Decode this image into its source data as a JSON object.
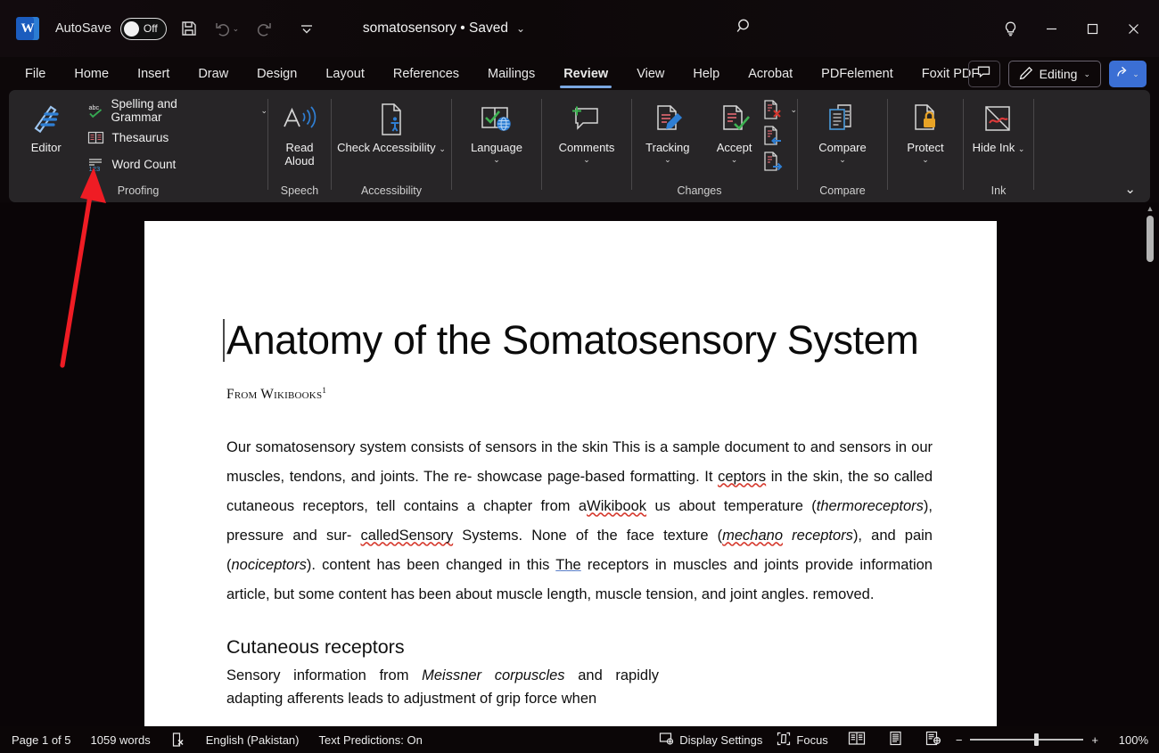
{
  "titlebar": {
    "app_icon": "word-logo",
    "autosave_label": "AutoSave",
    "autosave_state": "Off",
    "save_icon": "save-icon",
    "undo_icon": "undo-icon",
    "redo_icon": "redo-icon",
    "qat_more_icon": "quick-access-more-icon",
    "document_title": "somatosensory • Saved",
    "title_caret": "⌄",
    "search_icon": "search-icon",
    "tips_icon": "lightbulb-icon",
    "minimize": "–",
    "maximize": "▢",
    "close": "✕"
  },
  "tabs": {
    "items": [
      {
        "label": "File",
        "active": false
      },
      {
        "label": "Home",
        "active": false
      },
      {
        "label": "Insert",
        "active": false
      },
      {
        "label": "Draw",
        "active": false
      },
      {
        "label": "Design",
        "active": false
      },
      {
        "label": "Layout",
        "active": false
      },
      {
        "label": "References",
        "active": false
      },
      {
        "label": "Mailings",
        "active": false
      },
      {
        "label": "Review",
        "active": true
      },
      {
        "label": "View",
        "active": false
      },
      {
        "label": "Help",
        "active": false
      },
      {
        "label": "Acrobat",
        "active": false
      },
      {
        "label": "PDFelement",
        "active": false
      },
      {
        "label": "Foxit PDF",
        "active": false
      }
    ],
    "comments_icon": "comment-icon",
    "editing_label": "Editing",
    "editing_icon": "pen-icon",
    "editing_caret": "⌄",
    "share_icon": "share-icon",
    "share_caret": "⌄"
  },
  "ribbon": {
    "collapse_caret": "⌄",
    "groups": [
      {
        "name": "Proofing",
        "label": "Proofing",
        "big": {
          "label": "Editor",
          "icon": "editor-pen-icon"
        },
        "small": [
          {
            "label": "Spelling and Grammar",
            "icon": "spelling-abc-check-icon",
            "caret": "⌄"
          },
          {
            "label": "Thesaurus",
            "icon": "thesaurus-book-icon",
            "caret": ""
          },
          {
            "label": "Word Count",
            "icon": "word-count-icon",
            "caret": ""
          }
        ]
      },
      {
        "name": "Speech",
        "label": "Speech",
        "big": {
          "label": "Read Aloud",
          "icon": "read-aloud-icon"
        }
      },
      {
        "name": "Accessibility",
        "label": "Accessibility",
        "big": {
          "label": "Check Accessibility",
          "icon": "check-accessibility-icon",
          "caret": "⌄"
        }
      },
      {
        "name": "Language",
        "label": "",
        "big": {
          "label": "Language",
          "icon": "language-icon",
          "caret": "⌄"
        }
      },
      {
        "name": "Comments",
        "label": "",
        "big": {
          "label": "Comments",
          "icon": "new-comment-icon",
          "caret": "⌄"
        }
      },
      {
        "name": "Changes",
        "label": "Changes",
        "tracking": {
          "label": "Tracking",
          "icon": "track-changes-icon",
          "caret": "⌄"
        },
        "accept": {
          "label": "Accept",
          "icon": "accept-change-icon",
          "caret": "⌄"
        },
        "stack": [
          {
            "icon": "reject-change-icon",
            "caret": "⌄"
          },
          {
            "icon": "previous-change-icon",
            "caret": ""
          },
          {
            "icon": "next-change-icon",
            "caret": ""
          }
        ]
      },
      {
        "name": "Compare",
        "label": "Compare",
        "big": {
          "label": "Compare",
          "icon": "compare-docs-icon",
          "caret": "⌄"
        }
      },
      {
        "name": "Protect",
        "label": "",
        "big": {
          "label": "Protect",
          "icon": "protect-lock-icon",
          "caret": "⌄"
        }
      },
      {
        "name": "Ink",
        "label": "Ink",
        "big": {
          "label": "Hide Ink",
          "icon": "hide-ink-icon",
          "caret": "⌄"
        }
      }
    ]
  },
  "document": {
    "title": "Anatomy of the Somatosensory System",
    "subtitle": "From Wikibooks",
    "subtitle_sup": "1",
    "paragraph_parts": [
      {
        "t": "Our somatosensory system consists of sensors in the skin This is a sample document to and sensors in our muscles, tendons, and joints. The re- showcase page-based formatting. It ",
        "s": ""
      },
      {
        "t": "ceptors",
        "s": "sq-red"
      },
      {
        "t": " in the skin, the so called cutaneous receptors, tell contains a chapter from a",
        "s": ""
      },
      {
        "t": "Wikibook",
        "s": "sq-red"
      },
      {
        "t": " us about temperature (",
        "s": ""
      },
      {
        "t": "thermoreceptors",
        "s": "italic"
      },
      {
        "t": "), pressure and sur- ",
        "s": ""
      },
      {
        "t": "calledSensory",
        "s": "sq-red"
      },
      {
        "t": " Systems. None of the face texture (",
        "s": ""
      },
      {
        "t": "mechano",
        "s": "italic-red"
      },
      {
        "t": " ",
        "s": ""
      },
      {
        "t": "receptors",
        "s": "italic"
      },
      {
        "t": "), and pain (",
        "s": ""
      },
      {
        "t": "nociceptors",
        "s": "italic"
      },
      {
        "t": "). content has been changed in this ",
        "s": ""
      },
      {
        "t": "The",
        "s": "sq-blue"
      },
      {
        "t": " receptors in muscles and joints provide information article, but some content has been about muscle length, muscle tension, and joint angles. removed.",
        "s": ""
      }
    ],
    "heading2": "Cutaneous receptors",
    "paragraph2_parts": [
      {
        "t": "Sensory information from ",
        "s": ""
      },
      {
        "t": "Meissner corpuscles",
        "s": "italic"
      },
      {
        "t": " and rapidly adapting afferents leads to adjustment of grip force when",
        "s": ""
      }
    ],
    "scrollbar_up": "▲"
  },
  "annotation": {
    "arrow_color": "#ef1c24",
    "arrow_name": "red-pointer-arrow"
  },
  "statusbar": {
    "page": "Page 1 of 5",
    "words": "1059 words",
    "proofing_icon": "proofing-errors-icon",
    "language": "English (Pakistan)",
    "predictions": "Text Predictions: On",
    "display_settings": "Display Settings",
    "display_settings_icon": "display-settings-icon",
    "focus": "Focus",
    "focus_icon": "focus-icon",
    "view_read_icon": "read-mode-icon",
    "view_print_icon": "print-layout-icon",
    "view_web_icon": "web-layout-icon",
    "zoom_out": "−",
    "zoom_in": "+",
    "zoom_level": "100%"
  },
  "colors": {
    "accent_blue": "#3b6fd4",
    "tab_underline": "#7aa7e0",
    "ribbon_bg": "#272527",
    "window_bg": "#0c0709",
    "page_bg": "#ffffff",
    "annotation_red": "#ef1c24"
  }
}
